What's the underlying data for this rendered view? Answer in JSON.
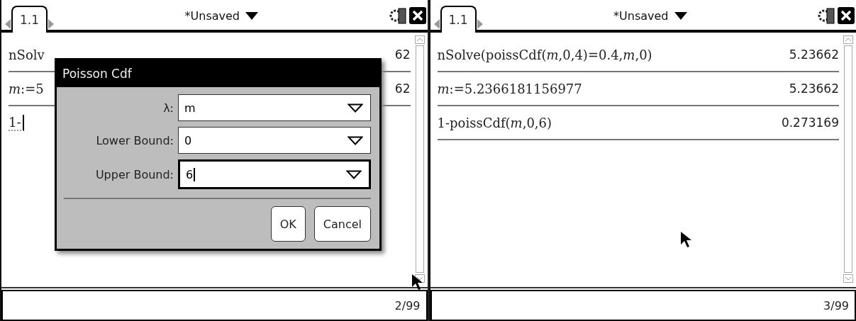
{
  "screens": [
    {
      "tab": {
        "label": "1.1",
        "selected": true
      },
      "title": "*Unsaved",
      "rows": [
        {
          "entry": "nSolv",
          "result": "62"
        },
        {
          "entry": "*m*:=5",
          "result": "62"
        },
        {
          "entry": "1-",
          "result": "",
          "editing": true
        }
      ],
      "status": "2/99",
      "dialog": {
        "title": "Poisson Cdf",
        "fields": [
          {
            "label": "λ:",
            "value": "m",
            "focused": false
          },
          {
            "label": "Lower Bound:",
            "value": "0",
            "focused": false
          },
          {
            "label": "Upper Bound:",
            "value": "6",
            "focused": true
          }
        ],
        "buttons": [
          "OK",
          "Cancel"
        ]
      }
    },
    {
      "tab": {
        "label": "1.1",
        "selected": true
      },
      "title": "*Unsaved",
      "rows": [
        {
          "entry": "nSolve(poissCdf(*m*,0,4)=0.4,*m*,0)",
          "result": "5.23662"
        },
        {
          "entry": "*m*:=5.2366181156977",
          "result": "5.23662"
        },
        {
          "entry": "1-poissCdf(*m*,0,6)",
          "result": "0.273169"
        }
      ],
      "status": "3/99"
    }
  ]
}
